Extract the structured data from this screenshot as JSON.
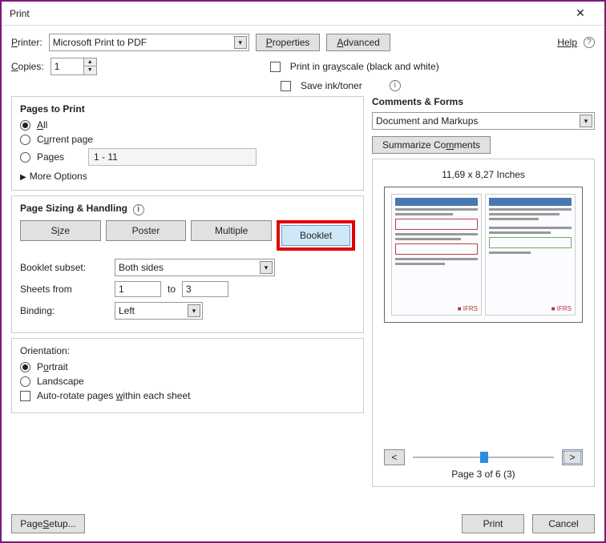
{
  "title": "Print",
  "help": "Help",
  "printer": {
    "label_html": "Printer:",
    "value": "Microsoft Print to PDF",
    "properties": "Properties",
    "advanced": "Advanced"
  },
  "copies": {
    "label": "Copies:",
    "value": "1"
  },
  "options": {
    "grayscale": "Print in grayscale (black and white)",
    "saveink": "Save ink/toner"
  },
  "pages": {
    "title": "Pages to Print",
    "all": "All",
    "current": "Current page",
    "pages": "Pages",
    "range": "1 - 11",
    "more": "More Options"
  },
  "sizing": {
    "title": "Page Sizing & Handling",
    "size": "Size",
    "poster": "Poster",
    "multiple": "Multiple",
    "booklet": "Booklet",
    "subset_label": "Booklet subset:",
    "subset_value": "Both sides",
    "sheets_label": "Sheets from",
    "sheets_from": "1",
    "sheets_to_label": "to",
    "sheets_to": "3",
    "binding_label": "Binding:",
    "binding_value": "Left"
  },
  "orientation": {
    "title": "Orientation:",
    "portrait": "Portrait",
    "landscape": "Landscape",
    "autorotate": "Auto-rotate pages within each sheet"
  },
  "comments": {
    "title": "Comments & Forms",
    "value": "Document and Markups",
    "summarize": "Summarize Comments"
  },
  "preview": {
    "dims": "11,69 x 8,27 Inches",
    "nav_prev": "<",
    "nav_next": ">",
    "page_label": "Page 3 of 6 (3)",
    "mini_logo": "■ IFRS"
  },
  "footer": {
    "pagesetup": "Page Setup...",
    "print": "Print",
    "cancel": "Cancel"
  }
}
